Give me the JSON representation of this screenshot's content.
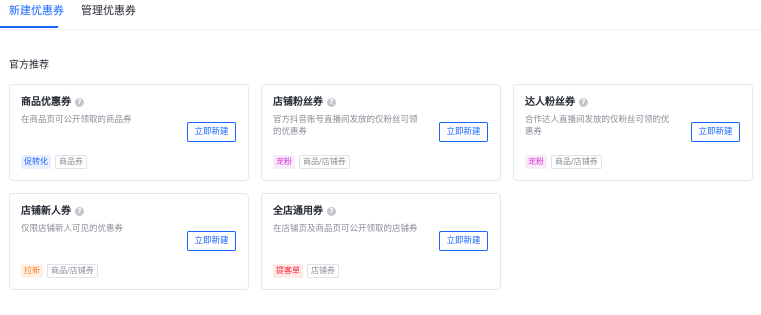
{
  "tabs": [
    {
      "label": "新建优惠券",
      "active": true
    },
    {
      "label": "管理优惠券",
      "active": false
    }
  ],
  "section_title": "官方推荐",
  "create_label": "立即新建",
  "colors": {
    "accent": "#1966ff"
  },
  "cards": [
    {
      "title": "商品优惠券",
      "desc": "在商品页可公开领取的商品券",
      "tags": [
        {
          "text": "促转化",
          "color": "#1966ff",
          "bg": "#e8f0ff"
        },
        {
          "text": "商品券",
          "plain": true
        }
      ]
    },
    {
      "title": "店铺粉丝券",
      "desc": "官方抖音账号直播间发放的仅粉丝可领的优惠券",
      "tags": [
        {
          "text": "宠粉",
          "color": "#d43bd4",
          "bg": "#fbeafb"
        },
        {
          "text": "商品/店铺券",
          "plain": true
        }
      ]
    },
    {
      "title": "达人粉丝券",
      "desc": "合作达人直播间发放的仅粉丝可领的优惠券",
      "tags": [
        {
          "text": "宠粉",
          "color": "#d43bd4",
          "bg": "#fbeafb"
        },
        {
          "text": "商品/店铺券",
          "plain": true
        }
      ]
    },
    {
      "title": "店铺新人券",
      "desc": "仅限店铺新人可见的优惠券",
      "tags": [
        {
          "text": "拉新",
          "color": "#ff7a1a",
          "bg": "#fff1e6"
        },
        {
          "text": "商品/店铺券",
          "plain": true
        }
      ]
    },
    {
      "title": "全店通用券",
      "desc": "在店铺页及商品页可公开领取的店铺券",
      "tags": [
        {
          "text": "提客单",
          "color": "#f5222d",
          "bg": "#ffe9e9"
        },
        {
          "text": "店铺券",
          "plain": true
        }
      ]
    }
  ]
}
